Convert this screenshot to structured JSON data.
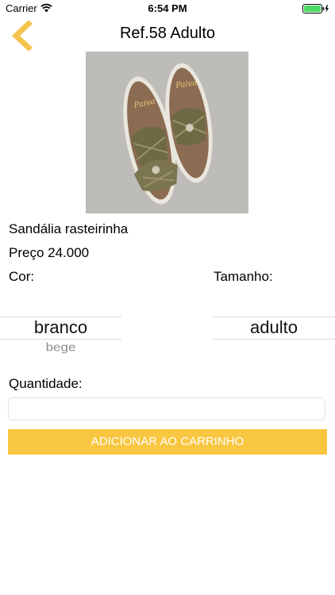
{
  "status_bar": {
    "carrier": "Carrier",
    "time": "6:54 PM",
    "battery": 1.0
  },
  "nav": {
    "title": "Ref.58 Adulto",
    "back_icon": "chevron-left-icon"
  },
  "product": {
    "image": "sandal-photo",
    "name": "Sandália rasteirinha",
    "price": "Preço 24.000"
  },
  "color": {
    "label": "Cor:",
    "selected": "branco",
    "next_option": "bege"
  },
  "size": {
    "label": "Tamanho:",
    "selected": "adulto"
  },
  "quantity": {
    "label": "Quantidade:",
    "value": "",
    "placeholder": ""
  },
  "cart_button": {
    "label": "ADICIONAR AO CARRINHO"
  },
  "colors": {
    "accent": "#F8C640",
    "back_chevron": "#F4C44E",
    "battery": "#4CD964"
  }
}
